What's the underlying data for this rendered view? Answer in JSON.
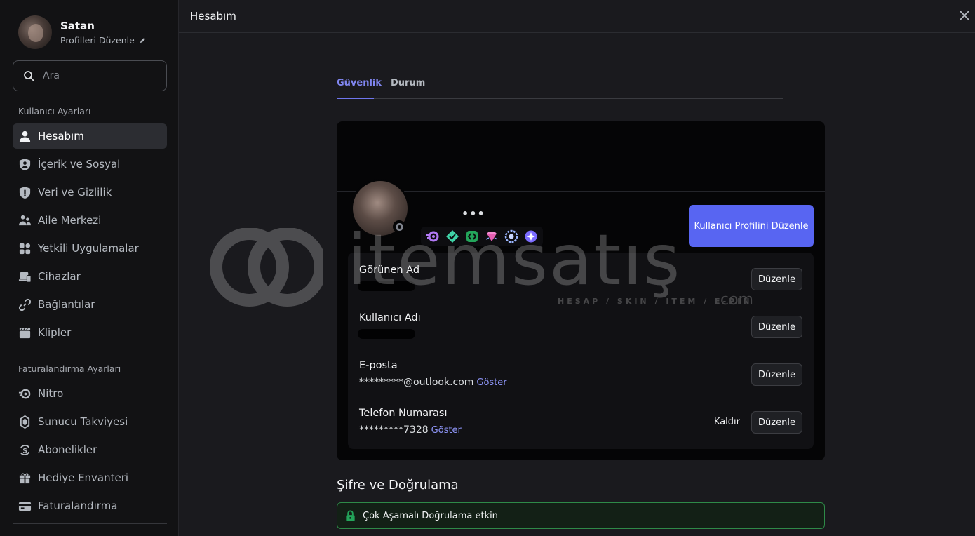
{
  "user": {
    "name": "Satan",
    "edit_profiles": "Profilleri Düzenle"
  },
  "search": {
    "placeholder": "Ara"
  },
  "sidebar": {
    "user_settings_title": "Kullanıcı Ayarları",
    "user_items": [
      {
        "label": "Hesabım",
        "icon": "person-icon"
      },
      {
        "label": "İçerik ve Sosyal",
        "icon": "shield-person-icon"
      },
      {
        "label": "Veri ve Gizlilik",
        "icon": "shield-lock-icon"
      },
      {
        "label": "Aile Merkezi",
        "icon": "family-icon"
      },
      {
        "label": "Yetkili Uygulamalar",
        "icon": "apps-icon"
      },
      {
        "label": "Cihazlar",
        "icon": "devices-icon"
      },
      {
        "label": "Bağlantılar",
        "icon": "link-icon"
      },
      {
        "label": "Klipler",
        "icon": "clapper-icon"
      }
    ],
    "billing_title": "Faturalandırma Ayarları",
    "billing_items": [
      {
        "label": "Nitro",
        "icon": "nitro-icon"
      },
      {
        "label": "Sunucu Takviyesi",
        "icon": "boost-icon"
      },
      {
        "label": "Abonelikler",
        "icon": "subscription-icon"
      },
      {
        "label": "Hediye Envanteri",
        "icon": "gift-icon"
      },
      {
        "label": "Faturalandırma",
        "icon": "card-icon"
      }
    ]
  },
  "topbar": {
    "title": "Hesabım"
  },
  "tabs": [
    {
      "label": "Güvenlik",
      "active": true
    },
    {
      "label": "Durum",
      "active": false
    }
  ],
  "profile": {
    "dots": "•••",
    "edit_profile_button": "Kullanıcı Profilini Düzenle",
    "badges": [
      "nitro-badge-icon",
      "hypesquad-badge-icon",
      "active-dev-badge-icon",
      "gem-badge-icon",
      "boost-badge-icon",
      "quest-badge-icon"
    ]
  },
  "fields": {
    "display_name": {
      "label": "Görünen Ad",
      "edit": "Düzenle"
    },
    "username": {
      "label": "Kullanıcı Adı",
      "edit": "Düzenle"
    },
    "email": {
      "label": "E-posta",
      "value": "*********@outlook.com",
      "show": "Göster",
      "edit": "Düzenle"
    },
    "phone": {
      "label": "Telefon Numarası",
      "value": "*********7328",
      "show": "Göster",
      "remove": "Kaldır",
      "edit": "Düzenle"
    }
  },
  "security": {
    "heading": "Şifre ve Doğrulama",
    "mfa_status": "Çok Aşamalı Doğrulama etkin"
  },
  "watermark": {
    "brand": "itemsatış",
    "tagline": "HESAP / SKIN / ITEM / E-PIN",
    "suffix": ".com"
  },
  "colors": {
    "accent": "#5865f2",
    "tab_active": "#8187f2",
    "link": "#8e95f7",
    "success_border": "#2e8a48"
  }
}
